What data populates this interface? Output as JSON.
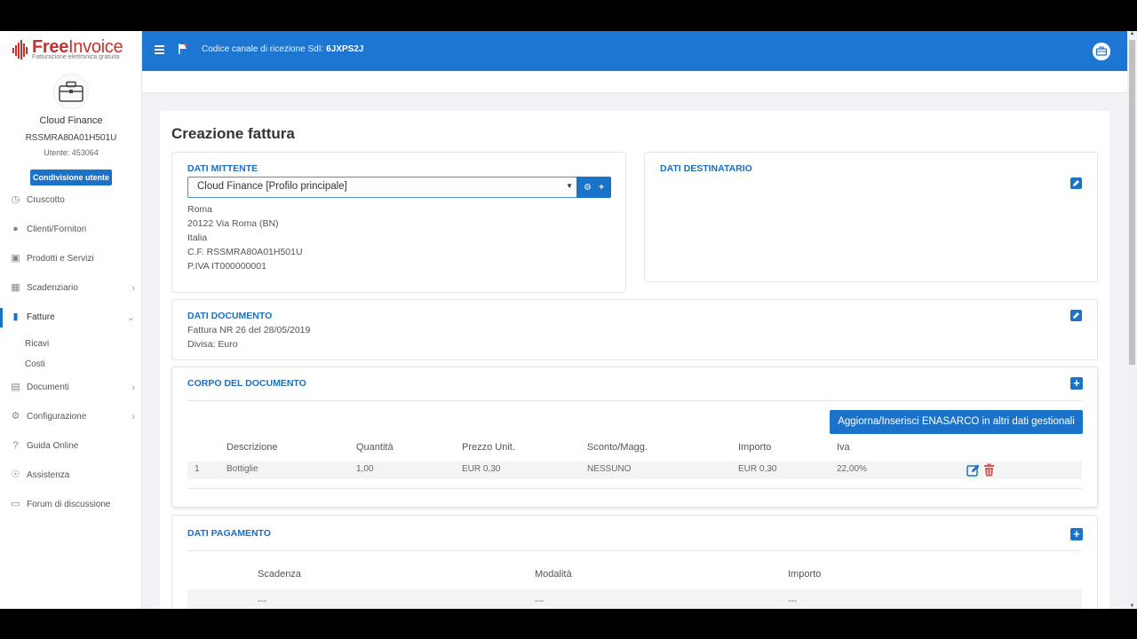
{
  "logo": {
    "brand_a": "Free",
    "brand_b": "Invoice",
    "tagline": "Fatturazione elettronica gratuita"
  },
  "profile": {
    "company": "Cloud Finance",
    "cf": "RSSMRA80A01H501U",
    "user": "Utente: 453064",
    "share_button": "Condivisione utente"
  },
  "nav": [
    {
      "label": "Cruscotto",
      "icon": "dashboard-icon"
    },
    {
      "label": "Clienti/Fornitori",
      "icon": "user-icon"
    },
    {
      "label": "Prodotti e Servizi",
      "icon": "basket-icon"
    },
    {
      "label": "Scadenziario",
      "icon": "calendar-icon"
    },
    {
      "label": "Fatture",
      "icon": "document-icon"
    },
    {
      "label": "Documenti",
      "icon": "files-icon"
    },
    {
      "label": "Configurazione",
      "icon": "gear-icon"
    },
    {
      "label": "Guida Online",
      "icon": "help-icon"
    },
    {
      "label": "Assistenza",
      "icon": "support-icon"
    },
    {
      "label": "Forum di discussione",
      "icon": "forum-icon"
    }
  ],
  "fatture_sub": [
    "Ricavi",
    "Costi"
  ],
  "topbar": {
    "sdi_label": "Codice canale di ricezione SdI:",
    "sdi_code": "6JXPS2J"
  },
  "page": {
    "title": "Creazione fattura"
  },
  "mittente": {
    "title": "DATI MITTENTE",
    "selected": "Cloud Finance [Profilo principale]",
    "address": [
      "Roma",
      "20122 Via Roma (BN)",
      "Italia",
      "C.F. RSSMRA80A01H501U",
      "P.IVA IT000000001"
    ]
  },
  "destinatario": {
    "title": "DATI DESTINATARIO"
  },
  "documento": {
    "title": "DATI DOCUMENTO",
    "line1": "Fattura NR 26 del 28/05/2019",
    "line2": "Divisa: Euro"
  },
  "corpo": {
    "title": "CORPO DEL DOCUMENTO",
    "enasarco_button": "Aggiorna/Inserisci ENASARCO in altri dati gestionali",
    "headers": [
      "Descrizione",
      "Quantità",
      "Prezzo Unit.",
      "Sconto/Magg.",
      "Importo",
      "Iva"
    ],
    "rows": [
      {
        "n": "1",
        "descrizione": "Bottiglie",
        "quantita": "1,00",
        "prezzo": "EUR 0,30",
        "sconto": "NESSUNO",
        "importo": "EUR 0,30",
        "iva": "22,00%"
      }
    ]
  },
  "pagamento": {
    "title": "DATI PAGAMENTO",
    "headers": [
      "Scadenza",
      "Modalità",
      "Importo"
    ],
    "row": [
      "---",
      "---",
      "---"
    ]
  },
  "colors": {
    "accent": "#1d76d2",
    "brand_red": "#c9302c",
    "delete_red": "#d9534f"
  }
}
